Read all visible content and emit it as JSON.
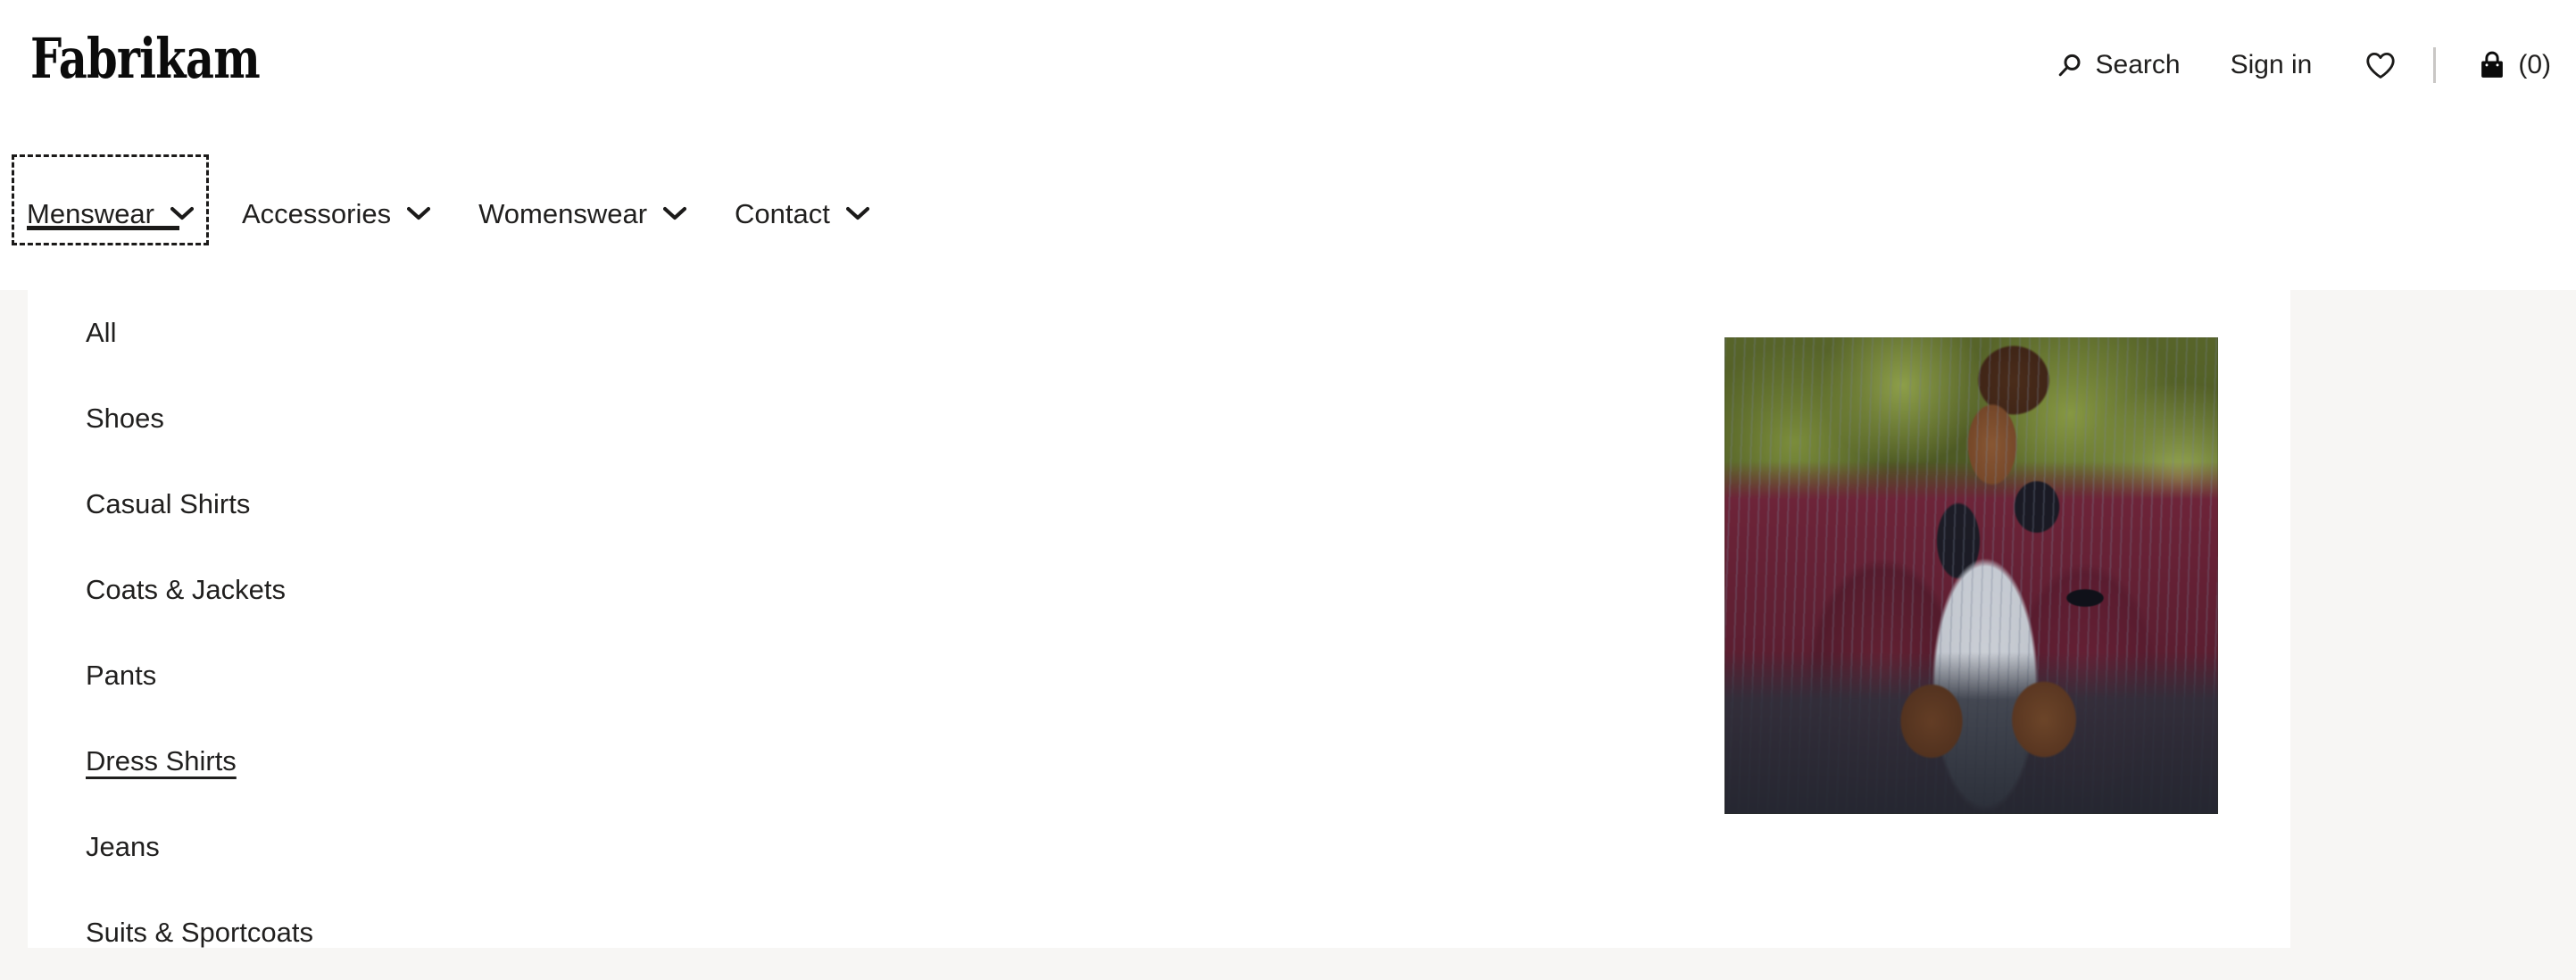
{
  "brand": {
    "name": "Fabrikam"
  },
  "header": {
    "search": {
      "label": "Search",
      "icon": "search-icon"
    },
    "signin": {
      "label": "Sign in"
    },
    "wishlist": {
      "icon": "heart-icon"
    },
    "cart": {
      "label": "(0)",
      "icon": "shopping-bag-icon",
      "count": 0
    }
  },
  "nav": {
    "items": [
      {
        "label": "Menswear",
        "icon": "chevron-down-icon",
        "active": true,
        "focused": true
      },
      {
        "label": "Accessories",
        "icon": "chevron-down-icon",
        "active": false,
        "focused": false
      },
      {
        "label": "Womenswear",
        "icon": "chevron-down-icon",
        "active": false,
        "focused": false
      },
      {
        "label": "Contact",
        "icon": "chevron-down-icon",
        "active": false,
        "focused": false
      }
    ]
  },
  "mega_menu": {
    "open_for": "Menswear",
    "items": [
      {
        "label": "All",
        "hovered": false
      },
      {
        "label": "Shoes",
        "hovered": false
      },
      {
        "label": "Casual Shirts",
        "hovered": false
      },
      {
        "label": "Coats & Jackets",
        "hovered": false
      },
      {
        "label": "Pants",
        "hovered": false
      },
      {
        "label": "Dress Shirts",
        "hovered": true
      },
      {
        "label": "Jeans",
        "hovered": false
      },
      {
        "label": "Suits & Sportcoats",
        "hovered": false
      }
    ],
    "promo": {
      "alt": "Man wearing a burgundy blazer over a striped shirt outdoors"
    }
  },
  "colors": {
    "text": "#201f1e",
    "panel": "#ffffff",
    "page_background": "#f7f6f4",
    "divider": "#c9c7c5",
    "accent_underline": "#1b1a19"
  }
}
